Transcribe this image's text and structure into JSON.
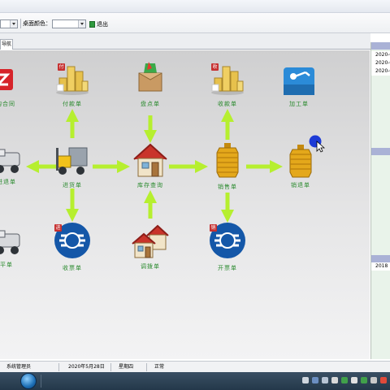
{
  "toolbar": {
    "desktop_color_label": "桌面颜色：",
    "desktop_color_value": "",
    "exit_label": "退出"
  },
  "tabs": [
    {
      "label": "导航"
    }
  ],
  "nav": {
    "label_color": "#2a8a2e",
    "arrow_color": "#b6ef2f",
    "nodes": {
      "contract": "采购合同",
      "payment": "付款单",
      "inventory_check": "盘点单",
      "receipt": "收款单",
      "processing": "加工单",
      "purchase_return": "进退单",
      "purchase": "进货单",
      "stock_transfer": "库存查询",
      "sales": "销售单",
      "sales_return": "销退单",
      "settle": "平单",
      "receive_invoice": "收票单",
      "transfer": "调拨单",
      "issue_invoice": "开票单"
    },
    "badges": {
      "payment": "付",
      "receipt": "收",
      "receive_invoice": "进",
      "issue_invoice": "销"
    }
  },
  "right_panel": {
    "dates": [
      "2020-0",
      "2020-0",
      "2020-0"
    ],
    "bottom_text": "2018"
  },
  "statusbar": {
    "user": "系统管理员",
    "date": "2020年5月28日",
    "weekday": "星期四",
    "status": "正常"
  }
}
